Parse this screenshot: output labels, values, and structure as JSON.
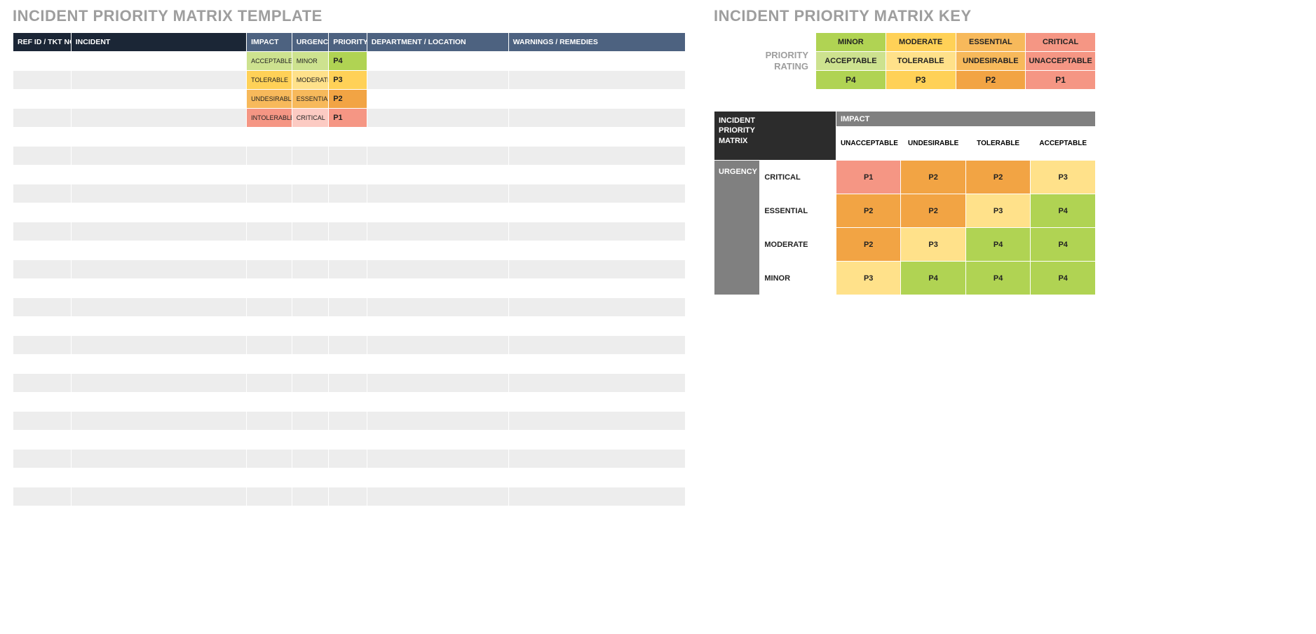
{
  "left": {
    "title": "INCIDENT PRIORITY MATRIX TEMPLATE",
    "headers": {
      "ref": "REF ID / TKT NO.",
      "incident": "INCIDENT",
      "impact": "IMPACT",
      "urgency": "URGENCY",
      "priority": "PRIORITY",
      "dept": "DEPARTMENT / LOCATION",
      "warn": "WARNINGS / REMEDIES"
    },
    "rows": [
      {
        "impact": "ACCEPTABLE",
        "urgency": "MINOR",
        "priority": "P4",
        "impact_cls": "c-green-lt",
        "urgency_cls": "c-green-lt",
        "priority_cls": "c-green"
      },
      {
        "impact": "TOLERABLE",
        "urgency": "MODERATE",
        "priority": "P3",
        "impact_cls": "c-yellow",
        "urgency_cls": "c-yellow-lt",
        "priority_cls": "c-yellow"
      },
      {
        "impact": "UNDESIRABLE",
        "urgency": "ESSENTIAL",
        "priority": "P2",
        "impact_cls": "c-orange",
        "urgency_cls": "c-orange",
        "priority_cls": "c-orange-d"
      },
      {
        "impact": "INTOLERABLE",
        "urgency": "CRITICAL",
        "priority": "P1",
        "impact_cls": "c-salmon",
        "urgency_cls": "c-salmon-lt",
        "priority_cls": "c-salmon"
      }
    ],
    "blank_rows": 20
  },
  "right": {
    "title": "INCIDENT PRIORITY MATRIX KEY",
    "rating": {
      "label1": "PRIORITY",
      "label2": "RATING",
      "cols": [
        {
          "severity": "MINOR",
          "impact": "ACCEPTABLE",
          "p": "P4",
          "sev_cls": "c-green",
          "imp_cls": "c-green-lt",
          "p_cls": "c-green"
        },
        {
          "severity": "MODERATE",
          "impact": "TOLERABLE",
          "p": "P3",
          "sev_cls": "c-yellow",
          "imp_cls": "c-yellow-lt",
          "p_cls": "c-yellow"
        },
        {
          "severity": "ESSENTIAL",
          "impact": "UNDESIRABLE",
          "p": "P2",
          "sev_cls": "c-orange",
          "imp_cls": "c-orange",
          "p_cls": "c-orange-d"
        },
        {
          "severity": "CRITICAL",
          "impact": "UNACCEPTABLE",
          "p": "P1",
          "sev_cls": "c-salmon",
          "imp_cls": "c-salmon",
          "p_cls": "c-salmon"
        }
      ]
    },
    "matrix": {
      "corner1": "INCIDENT",
      "corner2": "PRIORITY",
      "corner3": "MATRIX",
      "impact_label": "IMPACT",
      "urgency_label": "URGENCY",
      "impact_cols": [
        "UNACCEPTABLE",
        "UNDESIRABLE",
        "TOLERABLE",
        "ACCEPTABLE"
      ],
      "urgency_rows": [
        "CRITICAL",
        "ESSENTIAL",
        "MODERATE",
        "MINOR"
      ],
      "cells": [
        [
          {
            "v": "P1",
            "c": "c-salmon"
          },
          {
            "v": "P2",
            "c": "c-orange-d"
          },
          {
            "v": "P2",
            "c": "c-orange-d"
          },
          {
            "v": "P3",
            "c": "c-yellow-lt"
          }
        ],
        [
          {
            "v": "P2",
            "c": "c-orange-d"
          },
          {
            "v": "P2",
            "c": "c-orange-d"
          },
          {
            "v": "P3",
            "c": "c-yellow-lt"
          },
          {
            "v": "P4",
            "c": "c-green"
          }
        ],
        [
          {
            "v": "P2",
            "c": "c-orange-d"
          },
          {
            "v": "P3",
            "c": "c-yellow-lt"
          },
          {
            "v": "P4",
            "c": "c-green"
          },
          {
            "v": "P4",
            "c": "c-green"
          }
        ],
        [
          {
            "v": "P3",
            "c": "c-yellow-lt"
          },
          {
            "v": "P4",
            "c": "c-green"
          },
          {
            "v": "P4",
            "c": "c-green"
          },
          {
            "v": "P4",
            "c": "c-green"
          }
        ]
      ]
    }
  },
  "chart_data": {
    "type": "table",
    "title": "Incident Priority Matrix",
    "impact_levels": [
      "UNACCEPTABLE",
      "UNDESIRABLE",
      "TOLERABLE",
      "ACCEPTABLE"
    ],
    "urgency_levels": [
      "CRITICAL",
      "ESSENTIAL",
      "MODERATE",
      "MINOR"
    ],
    "priority_lookup": {
      "CRITICAL": {
        "UNACCEPTABLE": "P1",
        "UNDESIRABLE": "P2",
        "TOLERABLE": "P2",
        "ACCEPTABLE": "P3"
      },
      "ESSENTIAL": {
        "UNACCEPTABLE": "P2",
        "UNDESIRABLE": "P2",
        "TOLERABLE": "P3",
        "ACCEPTABLE": "P4"
      },
      "MODERATE": {
        "UNACCEPTABLE": "P2",
        "UNDESIRABLE": "P3",
        "TOLERABLE": "P4",
        "ACCEPTABLE": "P4"
      },
      "MINOR": {
        "UNACCEPTABLE": "P3",
        "UNDESIRABLE": "P4",
        "TOLERABLE": "P4",
        "ACCEPTABLE": "P4"
      }
    },
    "priority_rating_key": {
      "MINOR": "ACCEPTABLE → P4",
      "MODERATE": "TOLERABLE → P3",
      "ESSENTIAL": "UNDESIRABLE → P2",
      "CRITICAL": "UNACCEPTABLE → P1"
    }
  }
}
